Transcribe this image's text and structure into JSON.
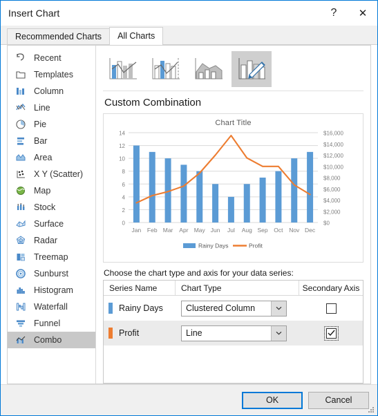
{
  "window": {
    "title": "Insert Chart",
    "help_label": "?",
    "close_label": "✕"
  },
  "tabs": [
    {
      "label": "Recommended Charts",
      "active": false
    },
    {
      "label": "All Charts",
      "active": true
    }
  ],
  "sidebar": {
    "items": [
      {
        "label": "Recent",
        "icon": "recent-icon",
        "selected": false
      },
      {
        "label": "Templates",
        "icon": "templates-icon",
        "selected": false
      },
      {
        "label": "Column",
        "icon": "column-chart-icon",
        "selected": false
      },
      {
        "label": "Line",
        "icon": "line-chart-icon",
        "selected": false
      },
      {
        "label": "Pie",
        "icon": "pie-chart-icon",
        "selected": false
      },
      {
        "label": "Bar",
        "icon": "bar-chart-icon",
        "selected": false
      },
      {
        "label": "Area",
        "icon": "area-chart-icon",
        "selected": false
      },
      {
        "label": "X Y (Scatter)",
        "icon": "scatter-chart-icon",
        "selected": false
      },
      {
        "label": "Map",
        "icon": "map-chart-icon",
        "selected": false
      },
      {
        "label": "Stock",
        "icon": "stock-chart-icon",
        "selected": false
      },
      {
        "label": "Surface",
        "icon": "surface-chart-icon",
        "selected": false
      },
      {
        "label": "Radar",
        "icon": "radar-chart-icon",
        "selected": false
      },
      {
        "label": "Treemap",
        "icon": "treemap-chart-icon",
        "selected": false
      },
      {
        "label": "Sunburst",
        "icon": "sunburst-chart-icon",
        "selected": false
      },
      {
        "label": "Histogram",
        "icon": "histogram-chart-icon",
        "selected": false
      },
      {
        "label": "Waterfall",
        "icon": "waterfall-chart-icon",
        "selected": false
      },
      {
        "label": "Funnel",
        "icon": "funnel-chart-icon",
        "selected": false
      },
      {
        "label": "Combo",
        "icon": "combo-chart-icon",
        "selected": true
      }
    ]
  },
  "thumbnails": [
    {
      "name": "clustered-column-line",
      "selected": false
    },
    {
      "name": "clustered-column-line-on-secondary-axis",
      "selected": false
    },
    {
      "name": "stacked-area-clustered-column",
      "selected": false
    },
    {
      "name": "custom-combination",
      "selected": true
    }
  ],
  "gallery": {
    "heading": "Custom Combination"
  },
  "table": {
    "caption": "Choose the chart type and axis for your data series:",
    "headers": [
      "Series Name",
      "Chart Type",
      "Secondary Axis"
    ],
    "rows": [
      {
        "series_name": "Rainy Days",
        "chart_type": "Clustered Column",
        "secondary_axis": false,
        "secondary_axis_focused": false,
        "swatch_color": "#5B9BD5"
      },
      {
        "series_name": "Profit",
        "chart_type": "Line",
        "secondary_axis": true,
        "secondary_axis_focused": true,
        "swatch_color": "#ED7D31"
      }
    ]
  },
  "footer": {
    "ok_label": "OK",
    "cancel_label": "Cancel"
  },
  "colors": {
    "series1": "#5B9BD5",
    "series2": "#ED7D31",
    "accent": "#0078d7",
    "gridline": "#d9d9d9",
    "axis_text": "#7f7f7f"
  },
  "chart_data": {
    "type": "bar",
    "title": "Chart Title",
    "categories": [
      "Jan",
      "Feb",
      "Mar",
      "Apr",
      "May",
      "Jun",
      "Jul",
      "Aug",
      "Sep",
      "Oct",
      "Nov",
      "Dec"
    ],
    "series": [
      {
        "name": "Rainy Days",
        "type": "bar",
        "axis": "primary",
        "color": "#5B9BD5",
        "values": [
          12,
          11,
          10,
          9,
          8,
          6,
          4,
          6,
          7,
          8,
          10,
          11
        ]
      },
      {
        "name": "Profit",
        "type": "line",
        "axis": "secondary",
        "color": "#ED7D31",
        "values": [
          3500,
          4800,
          5500,
          6500,
          8800,
          12000,
          15500,
          11500,
          10000,
          10000,
          6700,
          5000
        ]
      }
    ],
    "xlabel": "",
    "ylabel": "",
    "ylim": [
      0,
      14
    ],
    "yticks": [
      "0",
      "2",
      "4",
      "6",
      "8",
      "10",
      "12",
      "14"
    ],
    "y2lim": [
      0,
      16000
    ],
    "y2ticks": [
      "$0",
      "$2,000",
      "$4,000",
      "$6,000",
      "$8,000",
      "$10,000",
      "$12,000",
      "$14,000",
      "$16,000"
    ],
    "grid": true,
    "legend": [
      "Rainy Days",
      "Profit"
    ],
    "legend_position": "bottom"
  }
}
